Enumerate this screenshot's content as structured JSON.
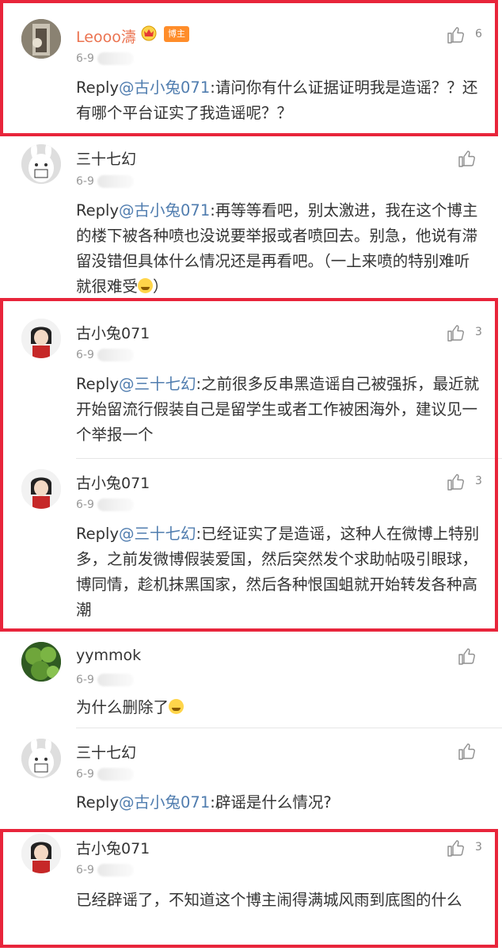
{
  "comments": [
    {
      "user": "Leooo濤",
      "badge": "博主",
      "time": "6-9",
      "likes": "6",
      "reply_prefix": "Reply",
      "mention": "@古小兔071",
      "text": ":请问你有什么证据证明我是造谣？？还有哪个平台证实了我造谣呢？？"
    },
    {
      "user": "三十七幻",
      "time": "6-9",
      "likes": "",
      "reply_prefix": "Reply",
      "mention": "@古小兔071",
      "text": ":再等等看吧，别太激进，我在这个博主的楼下被各种喷也没说要举报或者喷回去。别急，他说有滞留没错但具体什么情况还是再看吧。（一上来喷的特别难听就很难受",
      "text_end": "）"
    },
    {
      "user": "古小兔071",
      "time": "6-9",
      "likes": "3",
      "reply_prefix": "Reply",
      "mention": "@三十七幻",
      "text": ":之前很多反串黑造谣自己被强拆，最近就开始留流行假装自己是留学生或者工作被困海外，建议见一个举报一个"
    },
    {
      "user": "古小兔071",
      "time": "6-9",
      "likes": "3",
      "reply_prefix": "Reply",
      "mention": "@三十七幻",
      "text": ":已经证实了是造谣，这种人在微博上特别多，之前发微博假装爱国，然后突然发个求助帖吸引眼球，博同情，趁机抹黑国家，然后各种恨国蛆就开始转发各种高潮"
    },
    {
      "user": "yymmok",
      "time": "6-9",
      "likes": "",
      "text": "为什么删除了"
    },
    {
      "user": "三十七幻",
      "time": "6-9",
      "likes": "",
      "reply_prefix": "Reply",
      "mention": "@古小兔071",
      "text": ":辟谣是什么情况?"
    },
    {
      "user": "古小兔071",
      "time": "6-9",
      "likes": "3",
      "text": "已经辟谣了，不知道这个博主闹得满城风雨到底图的什么"
    }
  ],
  "icons": {
    "like": "thumbs-up-icon",
    "vip": "crown-badge-icon",
    "emoji": "laugh-cry-emoji-icon"
  },
  "colors": {
    "highlight_border": "#e8253b",
    "mention": "#507daf",
    "host_name": "#eb7350",
    "host_badge": "#ff8d2a"
  }
}
